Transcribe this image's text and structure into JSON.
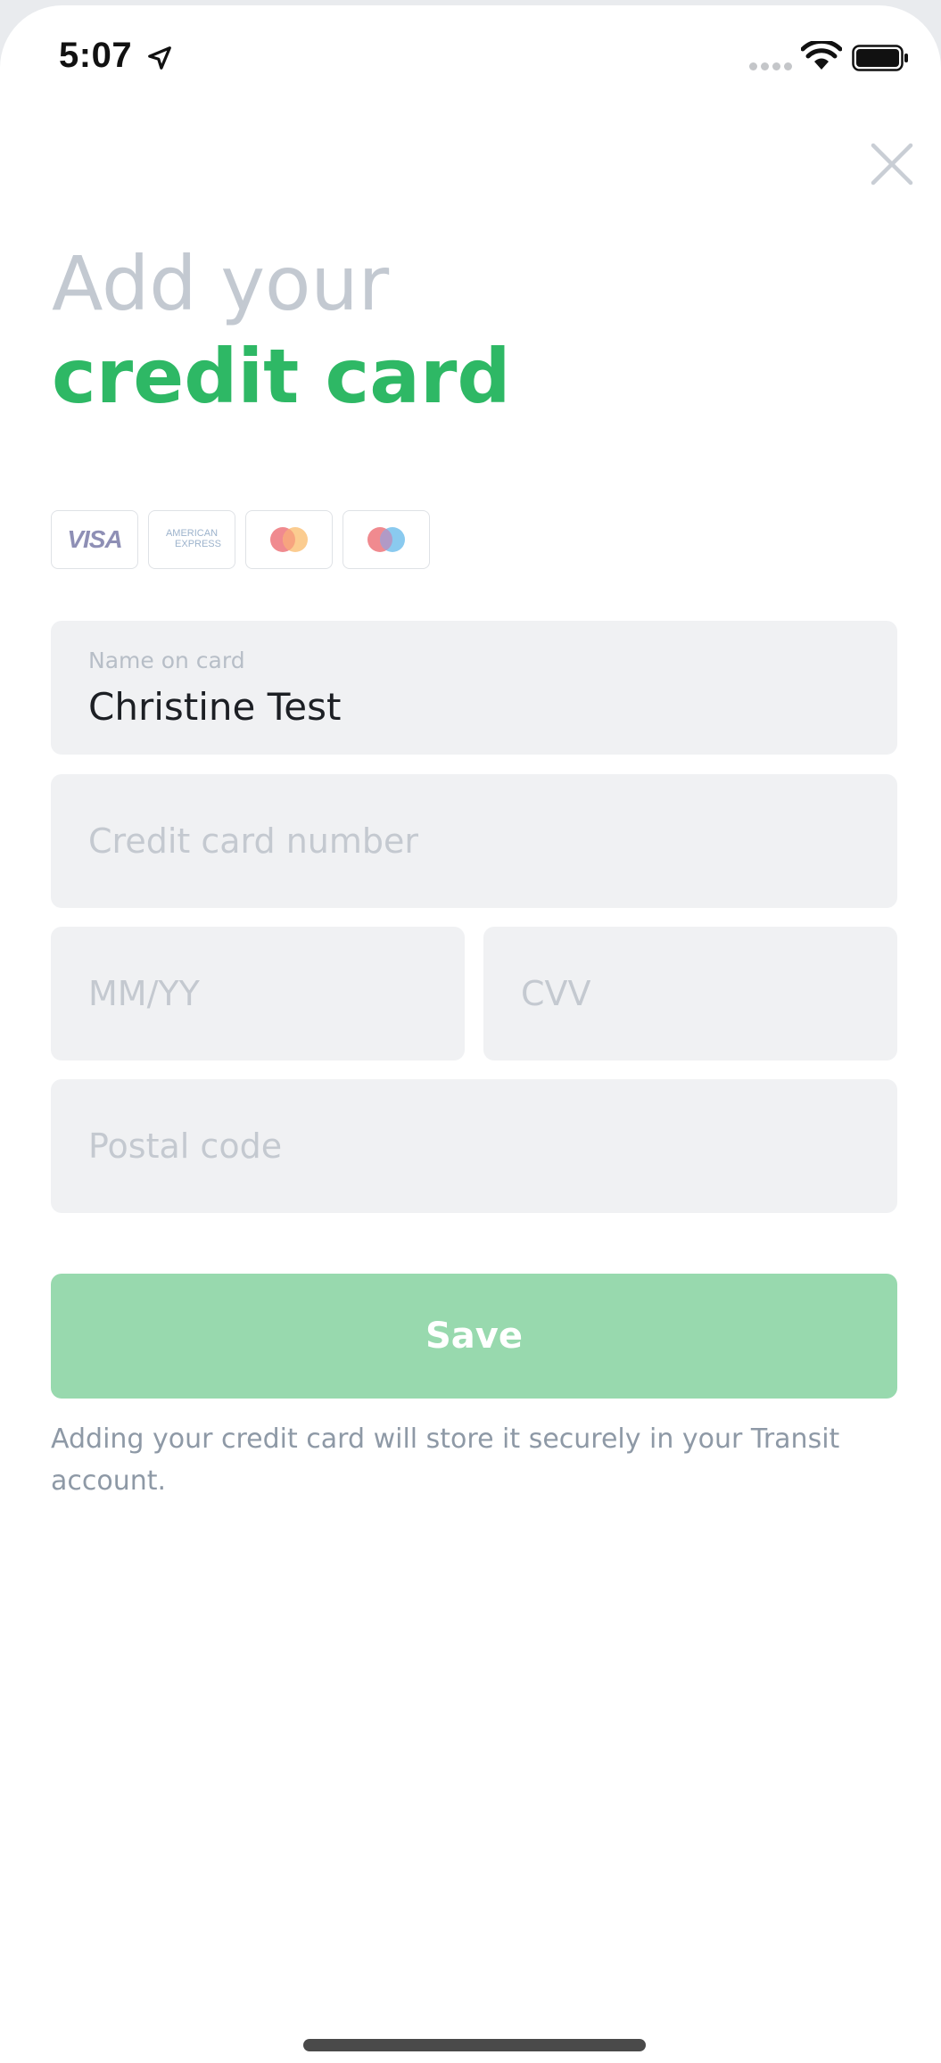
{
  "status_bar": {
    "time": "5:07"
  },
  "heading": {
    "line1": "Add your",
    "line2": "credit card"
  },
  "card_logos": {
    "visa": "VISA",
    "amex_line1": "AMERICAN",
    "amex_line2": "EXPRESS"
  },
  "form": {
    "name": {
      "label": "Name on card",
      "value": "Christine Test"
    },
    "card_number": {
      "placeholder": "Credit card number"
    },
    "expiry": {
      "placeholder": "MM/YY"
    },
    "cvv": {
      "placeholder": "CVV"
    },
    "postal": {
      "placeholder": "Postal code"
    }
  },
  "save_button": {
    "label": "Save"
  },
  "footnote": "Adding your credit card will store it securely in your Transit account.",
  "colors": {
    "accent_green": "#2eb865",
    "save_disabled": "#98d9ae",
    "heading_grey": "#c3c9d1"
  }
}
